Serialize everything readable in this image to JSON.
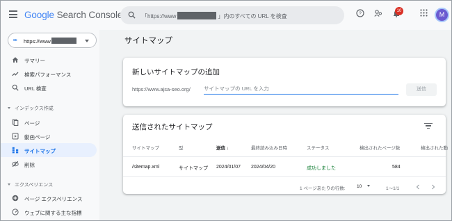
{
  "app": {
    "logo_google": "Google",
    "logo_product": "Search Console"
  },
  "search": {
    "prefix": "「https://www",
    "suffix": "」内のすべての URL を検査"
  },
  "topbar": {
    "notification_count": "10",
    "avatar_initial": "M"
  },
  "property": {
    "label": "https://www"
  },
  "sidebar": {
    "items": [
      {
        "label": "サマリー",
        "icon": "home-icon"
      },
      {
        "label": "検索パフォーマンス",
        "icon": "trending-icon"
      },
      {
        "label": "URL 検査",
        "icon": "search-icon"
      }
    ],
    "section_index": "インデックス作成",
    "index_items": [
      {
        "label": "ページ",
        "icon": "pages-icon"
      },
      {
        "label": "動画ページ",
        "icon": "video-pages-icon"
      },
      {
        "label": "サイトマップ",
        "icon": "sitemap-icon",
        "active": true
      },
      {
        "label": "削除",
        "icon": "remove-icon"
      }
    ],
    "section_experience": "エクスペリエンス",
    "experience_items": [
      {
        "label": "ページ エクスペリエンス",
        "icon": "plus-circle-icon"
      },
      {
        "label": "ウェブに関する主な指標",
        "icon": "speed-icon"
      }
    ]
  },
  "main": {
    "page_title": "サイトマップ",
    "add_card": {
      "title": "新しいサイトマップの追加",
      "url_prefix": "https://www.ajsa-seo.org/",
      "input_placeholder": "サイトマップの URL を入力",
      "input_value": "",
      "submit_label": "送信"
    },
    "submitted_card": {
      "title": "送信されたサイトマップ",
      "columns": [
        "サイトマップ",
        "型",
        "送信 ↓",
        "最終読み込み日時",
        "ステータス",
        "検出されたページ数",
        "検出された動"
      ],
      "rows": [
        {
          "sitemap": "/sitemap.xml",
          "type": "サイトマップ",
          "submitted": "2024/01/07",
          "last_read": "2024/04/20",
          "status": "成功しました",
          "pages": "584"
        }
      ],
      "rows_per_page_label": "1 ページあたりの行数:",
      "rows_per_page_value": "10",
      "range": "1〜1/1"
    }
  },
  "colors": {
    "accent": "#1a73e8",
    "active_bg": "#e8f0fe",
    "success": "#188038",
    "badge": "#d93025"
  }
}
